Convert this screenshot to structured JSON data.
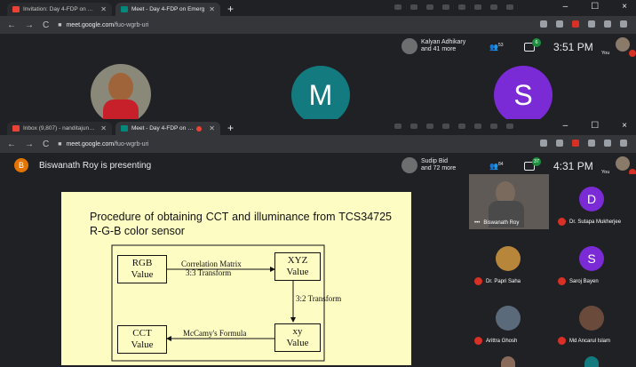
{
  "window1": {
    "tabs": [
      {
        "label": "Invitation: Day 4-FDP on Emergi",
        "active": false
      },
      {
        "label": "Meet - Day 4-FDP on Emerg",
        "active": true
      }
    ],
    "new_tab": "+",
    "controls": [
      "–",
      "☐",
      "×"
    ],
    "url_host": "meet.google.com",
    "url_path": "/fuo-wgrb-uri",
    "participant_name": "Kalyan Adhikary",
    "participant_more": "and 41 more",
    "people_count": "53",
    "chat_badge": "6",
    "time": "3:51 PM",
    "you_label": "You",
    "tiles": [
      {
        "letter": "M",
        "color": "#137a7f"
      },
      {
        "letter": "S",
        "color": "#7b2bd6"
      }
    ]
  },
  "window2": {
    "tabs": [
      {
        "label": "Inbox (9,807) - nanditajune93@",
        "active": false
      },
      {
        "label": "Meet - Day 4-FDP on Emerg",
        "active": true
      }
    ],
    "new_tab": "+",
    "controls": [
      "–",
      "☐",
      "×"
    ],
    "url_host": "meet.google.com",
    "url_path": "/fuo-wgrb-uri",
    "presenter_initial": "B",
    "presenting_text": "Biswanath Roy is presenting",
    "participant_name": "Sudip Bid",
    "participant_more": "and 72 more",
    "people_count": "84",
    "chat_badge": "37",
    "time": "4:31 PM",
    "you_label": "You"
  },
  "slide": {
    "title": "Procedure of obtaining CCT and illuminance from TCS34725 R-G-B color sensor",
    "box_rgb": [
      "RGB",
      "Value"
    ],
    "box_xyz": [
      "XYZ",
      "Value"
    ],
    "box_xy": [
      "xy",
      "Value"
    ],
    "box_cct": [
      "CCT",
      "Value"
    ],
    "arrow1": [
      "Correlation Matrix",
      "3:3 Transform"
    ],
    "arrow2": "3:2 Transform",
    "arrow3": "McCamy's Formula"
  },
  "sidebar": {
    "participants": [
      {
        "name": "Biswanath Roy",
        "type": "camera"
      },
      {
        "name": "Dr. Sutapa Mukherjee",
        "letter": "D",
        "color": "#7b2bd6"
      },
      {
        "name": "Dr. Papri Saha",
        "type": "photo"
      },
      {
        "name": "Saroj Bayen",
        "letter": "S",
        "color": "#7b2bd6"
      },
      {
        "name": "Arittra Ghosh",
        "type": "photo"
      },
      {
        "name": "Md Ancarul Islam",
        "type": "photo"
      }
    ]
  }
}
